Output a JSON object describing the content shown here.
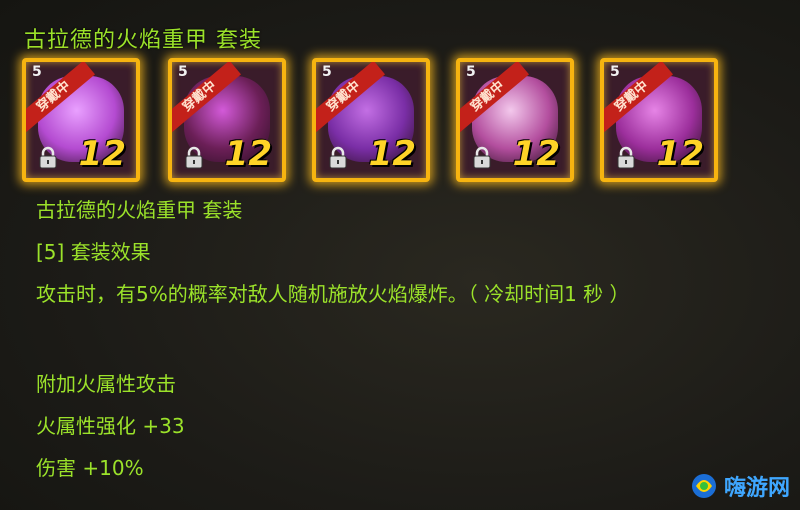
{
  "header": {
    "title": "古拉德的火焰重甲  套装"
  },
  "items": [
    {
      "stamp": "5",
      "ribbon": "穿戴中",
      "level": "12",
      "color_a": "#e9a0ff",
      "color_b": "#b44bd1"
    },
    {
      "stamp": "5",
      "ribbon": "穿戴中",
      "level": "12",
      "color_a": "#d35ad9",
      "color_b": "#6b1f57"
    },
    {
      "stamp": "5",
      "ribbon": "穿戴中",
      "level": "12",
      "color_a": "#c36fe4",
      "color_b": "#7a2ea6"
    },
    {
      "stamp": "5",
      "ribbon": "穿戴中",
      "level": "12",
      "color_a": "#f3c8ec",
      "color_b": "#b34e9e"
    },
    {
      "stamp": "5",
      "ribbon": "穿戴中",
      "level": "12",
      "color_a": "#e684e6",
      "color_b": "#9c2f9c"
    }
  ],
  "set": {
    "name": "古拉德的火焰重甲  套装",
    "effect_title": "[5] 套装效果",
    "description": "攻击时，有5%的概率对敌人随机施放火焰爆炸。（ 冷却时间1 秒 ）",
    "stats": [
      "附加火属性攻击",
      "火属性强化 +33",
      "伤害 +10%"
    ]
  },
  "watermark": {
    "text": "嗨游网",
    "icon": "hiyou-logo-icon"
  },
  "colors": {
    "text_green": "#9be22a",
    "frame_gold": "#f7b410",
    "level_yellow": "#ffd427"
  }
}
